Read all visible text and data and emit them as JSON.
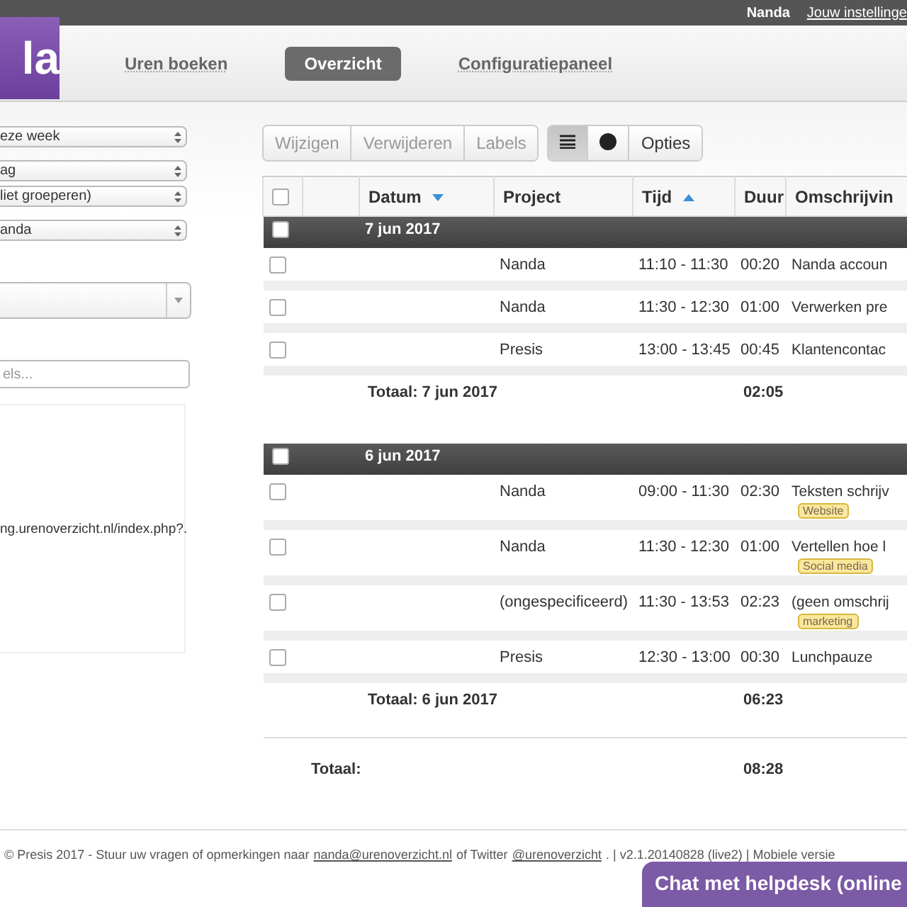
{
  "top_bar": {
    "user": "Nanda",
    "settings_link": "Jouw instellinge"
  },
  "logo": {
    "text": "la"
  },
  "nav": [
    {
      "label": "Uren boeken",
      "selected": false
    },
    {
      "label": "Overzicht",
      "selected": true
    },
    {
      "label": "Configuratiepaneel",
      "selected": false
    }
  ],
  "sidebar": {
    "select_groups": [
      [
        {
          "value": "eze week"
        }
      ],
      [
        {
          "value": "ag"
        },
        {
          "value": "liet groeperen)"
        }
      ],
      [
        {
          "value": "anda"
        }
      ]
    ],
    "search": {
      "placeholder": "els..."
    },
    "preview": {
      "text": "ng.urenoverzicht.nl/index.php?."
    }
  },
  "toolbar": {
    "actions": [
      {
        "label": "Wijzigen",
        "disabled": true
      },
      {
        "label": "Verwijderen",
        "disabled": true
      },
      {
        "label": "Labels",
        "disabled": true
      }
    ],
    "views": [
      {
        "kind": "list",
        "selected": true
      },
      {
        "kind": "pie",
        "selected": false
      }
    ],
    "options": "Opties"
  },
  "table": {
    "header_checked": false,
    "columns": [
      {
        "kind": "check"
      },
      {
        "kind": "blank"
      },
      {
        "kind": "text",
        "label": "Datum",
        "sorted": true,
        "ascending": false
      },
      {
        "kind": "text",
        "label": "Project",
        "sorted": false
      },
      {
        "kind": "text",
        "label": "Tijd",
        "sorted": true,
        "ascending": true
      },
      {
        "kind": "text",
        "label": "Duur",
        "sorted": false
      },
      {
        "kind": "text",
        "label": "Omschrijvin",
        "sorted": false
      }
    ],
    "groups": [
      {
        "date": "7 jun 2017",
        "checked": false,
        "rows": [
          {
            "checked": false,
            "project": "Nanda",
            "time": "11:10 - 11:30",
            "duration": "00:20",
            "description": "Nanda accoun",
            "tags": []
          },
          {
            "checked": false,
            "project": "Nanda",
            "time": "11:30 - 12:30",
            "duration": "01:00",
            "description": "Verwerken pre",
            "tags": []
          },
          {
            "checked": false,
            "project": "Presis",
            "time": "13:00 - 13:45",
            "duration": "00:45",
            "description": "Klantencontac",
            "tags": []
          }
        ],
        "total_label": "Totaal: 7 jun 2017",
        "total": "02:05"
      },
      {
        "date": "6 jun 2017",
        "checked": false,
        "rows": [
          {
            "checked": false,
            "project": "Nanda",
            "time": "09:00 - 11:30",
            "duration": "02:30",
            "description": "Teksten schrijv",
            "tags": [
              "Website"
            ]
          },
          {
            "checked": false,
            "project": "Nanda",
            "time": "11:30 - 12:30",
            "duration": "01:00",
            "description": "Vertellen hoe l",
            "tags": [
              "Social media"
            ]
          },
          {
            "checked": false,
            "project": "(ongespecificeerd)",
            "time": "11:30 - 13:53",
            "duration": "02:23",
            "description": "(geen omschrij",
            "tags": [
              "marketing"
            ]
          },
          {
            "checked": false,
            "project": "Presis",
            "time": "12:30 - 13:00",
            "duration": "00:30",
            "description": "Lunchpauze",
            "tags": []
          }
        ],
        "total_label": "Totaal: 6 jun 2017",
        "total": "06:23"
      }
    ],
    "grand_total_label": "Totaal:",
    "grand_total": "08:28"
  },
  "footer": {
    "text_before": "© Presis 2017 - Stuur uw vragen of opmerkingen naar",
    "email": "nanda@urenoverzicht.nl",
    "text_mid": "of Twitter",
    "twitter": "@urenoverzicht",
    "text_after": ". | v2.1.20140828 (live2) | Mobiele versie"
  },
  "chat": {
    "label": "Chat met helpdesk (online"
  }
}
